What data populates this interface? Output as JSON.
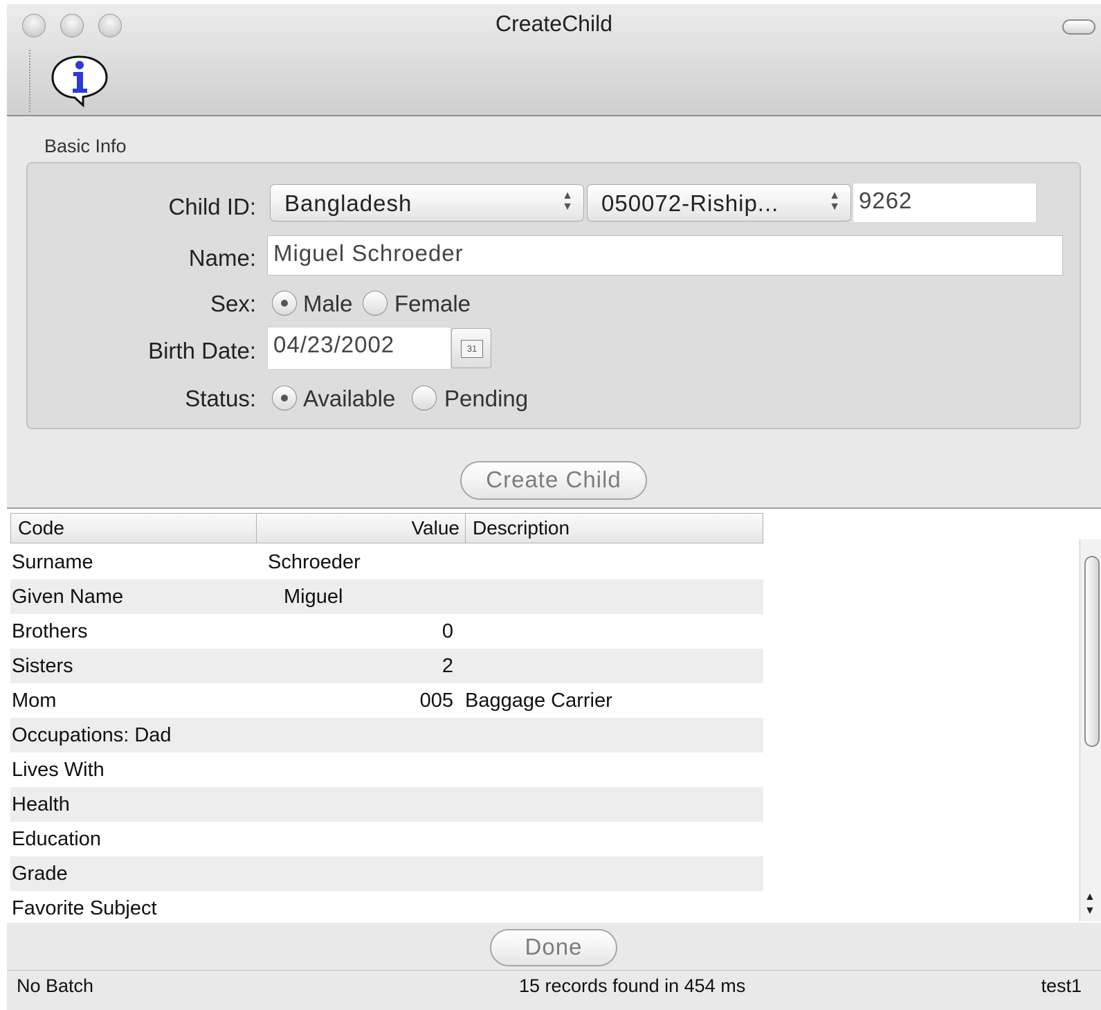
{
  "window": {
    "title": "CreateChild"
  },
  "toolbar": {
    "info_icon": "info-bubble-icon"
  },
  "basic_info": {
    "group_label": "Basic Info",
    "child_id_label": "Child ID:",
    "country_value": "Bangladesh",
    "project_value": "050072-Riship...",
    "child_number": "9262",
    "name_label": "Name:",
    "name_value": "Miguel Schroeder",
    "sex_label": "Sex:",
    "sex_options": [
      "Male",
      "Female"
    ],
    "sex_selected": "Male",
    "birth_date_label": "Birth Date:",
    "birth_date_value": "04/23/2002",
    "calendar_icon_text": "31",
    "status_label": "Status:",
    "status_options": [
      "Available",
      "Pending"
    ],
    "status_selected": "Available"
  },
  "create_button": "Create Child",
  "table": {
    "columns": [
      "Code",
      "Value",
      "Description"
    ],
    "rows": [
      {
        "code": "Surname",
        "value": "Schroeder",
        "description": ""
      },
      {
        "code": "Given Name",
        "value": "Miguel",
        "description": ""
      },
      {
        "code": "Brothers",
        "value": "0",
        "description": ""
      },
      {
        "code": "Sisters",
        "value": "2",
        "description": ""
      },
      {
        "code": "Mom",
        "value": "005",
        "description": "Baggage Carrier"
      },
      {
        "code": "Occupations: Dad",
        "value": "",
        "description": ""
      },
      {
        "code": "Lives With",
        "value": "",
        "description": ""
      },
      {
        "code": "Health",
        "value": "",
        "description": ""
      },
      {
        "code": "Education",
        "value": "",
        "description": ""
      },
      {
        "code": "Grade",
        "value": "",
        "description": ""
      },
      {
        "code": "Favorite Subject",
        "value": "",
        "description": ""
      }
    ]
  },
  "done_button": "Done",
  "statusbar": {
    "left": "No Batch",
    "center": "15 records found in 454 ms",
    "right": "test1"
  }
}
